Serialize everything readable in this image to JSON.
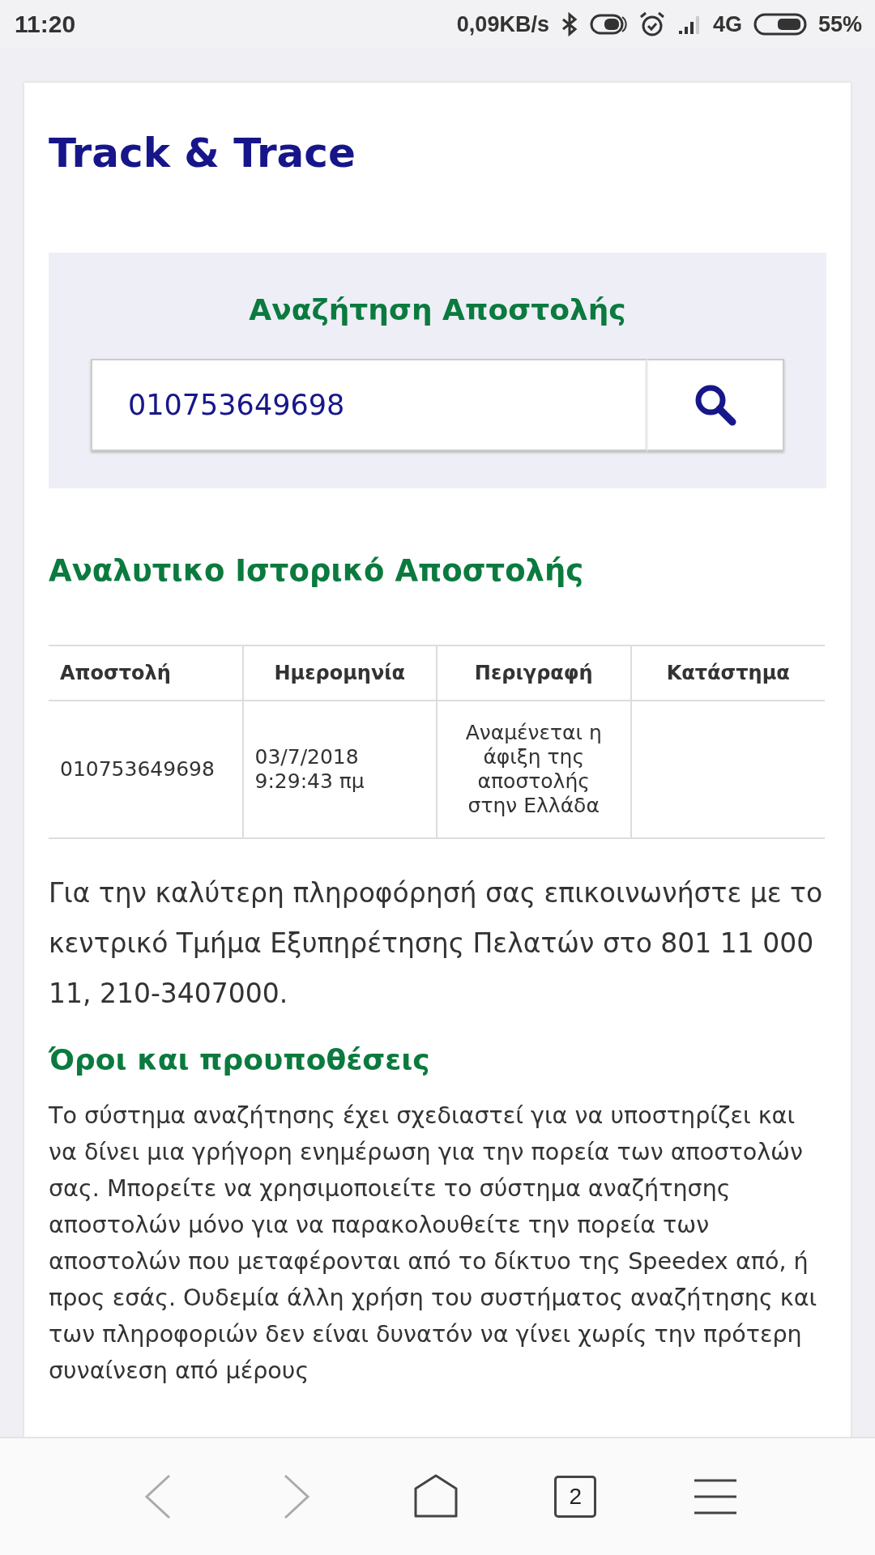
{
  "status_bar": {
    "time": "11:20",
    "speed": "0,09KB/s",
    "network": "4G",
    "battery": "55%"
  },
  "page": {
    "title": "Track & Trace",
    "search": {
      "heading": "Αναζήτηση Αποστολής",
      "value": "010753649698"
    },
    "history_heading": "Αναλυτικο Ιστορικό Αποστολής",
    "table": {
      "columns": [
        "Αποστολή",
        "Ημερομηνία",
        "Περιγραφή",
        "Κατάστημα"
      ],
      "rows": [
        [
          "010753649698",
          "03/7/2018\n9:29:43 πμ",
          "Αναμένεται η\nάφιξη της\nαποστολής\nστην Ελλάδα",
          ""
        ]
      ]
    },
    "contact_text": "Για την καλύτερη πληροφόρησή σας επικοινωνήστε με το κεντρικό Τμήμα Εξυπηρέτησης Πελατών στο 801 11 000 11, 210-3407000.",
    "terms_heading": "Όροι και προυποθέσεις",
    "terms_text": "Το σύστημα αναζήτησης έχει σχεδιαστεί για να υποστηρίζει και να δίνει μια γρήγορη ενημέρωση για την πορεία των αποστολών σας. Μπορείτε να χρησιμοποιείτε το σύστημα αναζήτησης αποστολών μόνο για να παρακολουθείτε την πορεία των αποστολών που μεταφέρονται από το δίκτυο της Speedex από, ή προς εσάς. Ουδεμία άλλη χρήση του συστήματος αναζήτησης και των πληροφοριών δεν είναι δυνατόν να γίνει χωρίς την πρότερη συναίνεση από μέρους"
  },
  "nav_bar": {
    "tab_count": "2",
    "back_disabled": true,
    "forward_disabled": true
  }
}
